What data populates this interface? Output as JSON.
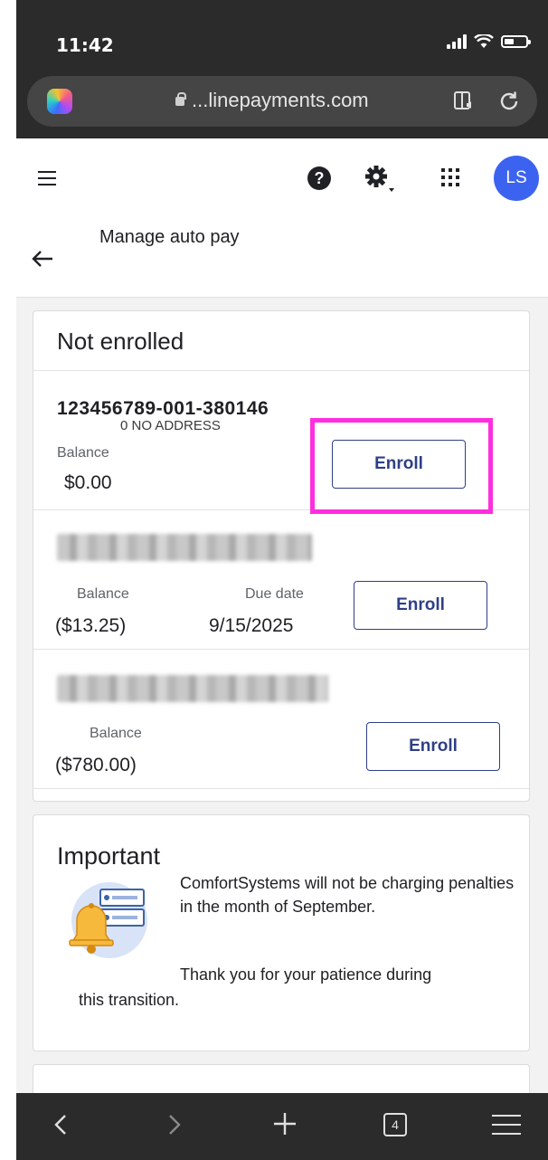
{
  "status_bar": {
    "time": "11:42"
  },
  "browser": {
    "url": "...linepayments.com",
    "open_tabs": "4"
  },
  "header": {
    "avatar_initials": "LS"
  },
  "page": {
    "title": "Manage auto pay"
  },
  "not_enrolled": {
    "heading": "Not enrolled",
    "enroll_label": "Enroll",
    "accounts": [
      {
        "number": "123456789-001-380146",
        "address": "0 NO ADDRESS",
        "balance_label": "Balance",
        "balance": "$0.00"
      },
      {
        "balance_label": "Balance",
        "balance": "($13.25)",
        "due_label": "Due date",
        "due_date": "9/15/2025"
      },
      {
        "balance_label": "Balance",
        "balance": "($780.00)"
      }
    ]
  },
  "important": {
    "title": "Important",
    "message": "ComfortSystems will not be charging penalties in the month of September.",
    "thanks_line1": "Thank you for your patience during",
    "thanks_line2": "this transition."
  },
  "colors": {
    "brand_blue": "#2f3f86",
    "avatar_blue": "#3c63f0",
    "highlight": "#ff2ee0"
  }
}
